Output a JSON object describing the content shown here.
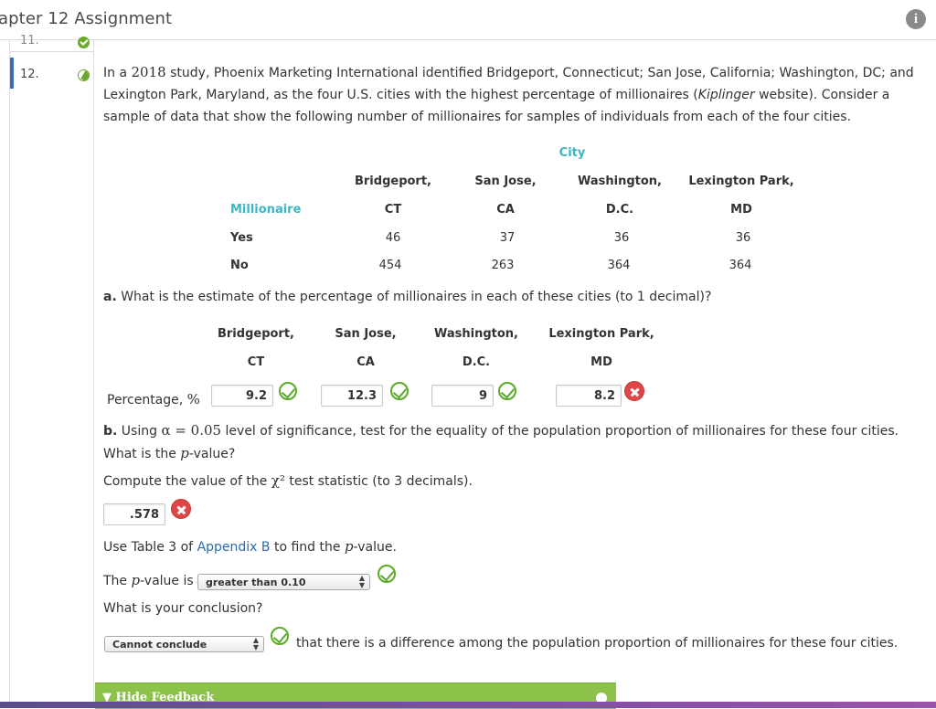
{
  "header": {
    "title": "apter 12 Assignment",
    "info_icon": "info-icon"
  },
  "questions_nav": [
    {
      "number": "11.",
      "status": "correct"
    },
    {
      "number": "12.",
      "status": "partial"
    }
  ],
  "question": {
    "intro_pre": "In a ",
    "intro_year": "2018",
    "intro_mid": " study, Phoenix Marketing International identified Bridgeport, Connecticut; San Jose, California; Washington, DC; and Lexington Park, Maryland, as the four U.S. cities with the highest percentage of millionaires (",
    "intro_italic": "Kiplinger",
    "intro_post": " website). Consider a sample of data that show the following number of millionaires for samples of individuals from each of the four cities.",
    "table": {
      "group_header": "City",
      "row_header": "Millionaire",
      "columns": [
        {
          "line1": "Bridgeport,",
          "line2": "CT"
        },
        {
          "line1": "San Jose,",
          "line2": "CA"
        },
        {
          "line1": "Washington,",
          "line2": "D.C."
        },
        {
          "line1": "Lexington Park,",
          "line2": "MD"
        }
      ],
      "rows": [
        {
          "label": "Yes",
          "values": [
            "46",
            "37",
            "36",
            "36"
          ]
        },
        {
          "label": "No",
          "values": [
            "454",
            "263",
            "364",
            "364"
          ]
        }
      ]
    },
    "part_a": {
      "label": "a.",
      "text": " What is the estimate of the percentage of millionaires in each of these cities (to 1 decimal)?",
      "columns": [
        {
          "line1": "Bridgeport,",
          "line2": "CT"
        },
        {
          "line1": "San Jose,",
          "line2": "CA"
        },
        {
          "line1": "Washington,",
          "line2": "D.C."
        },
        {
          "line1": "Lexington Park,",
          "line2": "MD"
        }
      ],
      "row_label": "Percentage, ",
      "row_label_symbol": "%",
      "answers": [
        {
          "value": "9.2",
          "status": "correct"
        },
        {
          "value": "12.3",
          "status": "correct"
        },
        {
          "value": "9",
          "status": "correct"
        },
        {
          "value": "8.2",
          "status": "incorrect"
        }
      ]
    },
    "part_b": {
      "label": "b.",
      "text_pre": " Using ",
      "alpha": "α = 0.05",
      "text_post": " level of significance, test for the equality of the population proportion of millionaires for these four cities. What is the ",
      "p": "p",
      "text_end": "-value?",
      "chi_prompt_pre": "Compute the value of the ",
      "chi_symbol": "χ²",
      "chi_prompt_post": " test statistic (to 3 decimals).",
      "chi_answer": {
        "value": ".578",
        "status": "incorrect"
      },
      "table_prompt_pre": "Use Table 3 of ",
      "table_prompt_link": "Appendix B",
      "table_prompt_mid": " to find the ",
      "table_prompt_p": "p",
      "table_prompt_post": "-value.",
      "pvalue_label_pre": "The ",
      "pvalue_label_p": "p",
      "pvalue_label_post": "-value is",
      "pvalue_select": {
        "value": "greater than 0.10",
        "status": "correct"
      },
      "conclusion_prompt": "What is your conclusion?",
      "conclusion_select": {
        "value": "Cannot conclude",
        "status": "correct"
      },
      "conclusion_text": "that there is a difference among the population proportion of millionaires for these four cities."
    },
    "feedback": {
      "label": "Hide Feedback"
    }
  }
}
